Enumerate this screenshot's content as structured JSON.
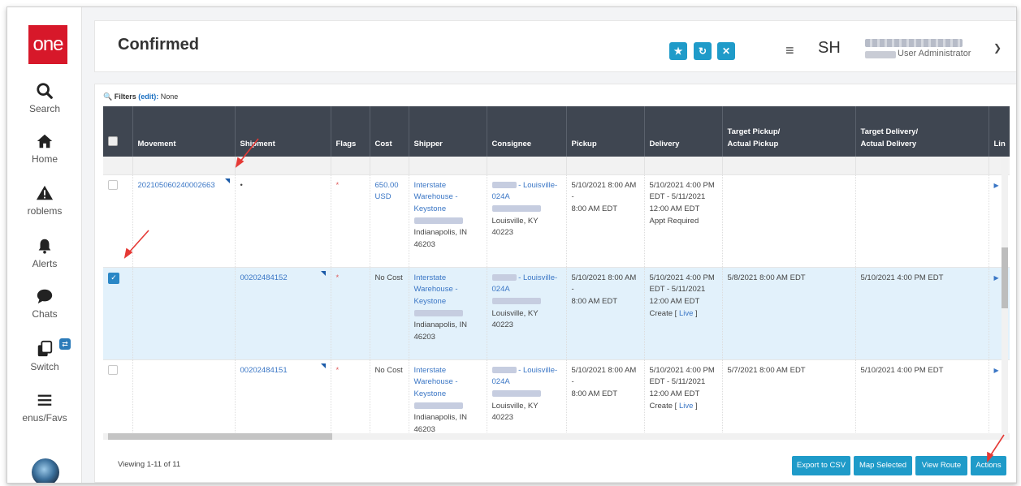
{
  "app": {
    "logo_text": "one",
    "title": "Confirmed"
  },
  "sidebar": {
    "items": [
      {
        "label": "Search",
        "icon": "search-icon"
      },
      {
        "label": "Home",
        "icon": "home-icon"
      },
      {
        "label": "Problems",
        "icon": "warning-icon",
        "display": "roblems"
      },
      {
        "label": "Alerts",
        "icon": "bell-icon"
      },
      {
        "label": "Chats",
        "icon": "chat-icon"
      },
      {
        "label": "Switch",
        "icon": "switch-icon"
      },
      {
        "label": "Menus/Favs",
        "icon": "menu-icon",
        "display": "enus/Favs"
      }
    ]
  },
  "header": {
    "buttons": [
      {
        "name": "favorite-star",
        "glyph": "★"
      },
      {
        "name": "refresh",
        "glyph": "↻"
      },
      {
        "name": "close",
        "glyph": "✕"
      }
    ],
    "user_initials": "SH",
    "user_role": "User Administrator"
  },
  "filters": {
    "label": "Filters",
    "edit": "(edit):",
    "value": "None"
  },
  "table": {
    "columns": [
      "",
      "Movement",
      "Shipment",
      "Flags",
      "Cost",
      "Shipper",
      "Consignee",
      "Pickup",
      "Delivery",
      "Target Pickup/\nActual Pickup",
      "Target Delivery/\nActual Delivery",
      "Lin"
    ],
    "rows": [
      {
        "selected": false,
        "movement": "202105060240002663",
        "shipment": "•",
        "flags": "*",
        "cost": "650.00 USD",
        "shipper": [
          "Interstate",
          "Warehouse -",
          "Keystone"
        ],
        "shipper_addr": [
          "Indianapolis, IN",
          "46203"
        ],
        "consignee_suffix": "- Louisville-",
        "consignee_code": "024A",
        "consignee_addr": "Louisville, KY 40223",
        "pickup": [
          "5/10/2021 8:00 AM -",
          "8:00 AM EDT"
        ],
        "delivery": [
          "5/10/2021 4:00 PM",
          "EDT - 5/11/2021",
          "12:00 AM EDT",
          "Appt Required"
        ],
        "target_pickup": "",
        "target_delivery": ""
      },
      {
        "selected": true,
        "movement": "",
        "shipment": "00202484152",
        "flags": "*",
        "cost": "No Cost",
        "shipper": [
          "Interstate",
          "Warehouse -",
          "Keystone"
        ],
        "shipper_addr": [
          "Indianapolis, IN",
          "46203"
        ],
        "consignee_suffix": "- Louisville-",
        "consignee_code": "024A",
        "consignee_addr": "Louisville, KY 40223",
        "pickup": [
          "5/10/2021 8:00 AM -",
          "8:00 AM EDT"
        ],
        "delivery": [
          "5/10/2021 4:00 PM",
          "EDT - 5/11/2021",
          "12:00 AM EDT"
        ],
        "delivery_link_prefix": "Create [ ",
        "delivery_link": "Live",
        "delivery_link_suffix": " ]",
        "target_pickup": "5/8/2021 8:00 AM EDT",
        "target_delivery": "5/10/2021 4:00 PM EDT"
      },
      {
        "selected": false,
        "movement": "",
        "shipment": "00202484151",
        "flags": "*",
        "cost": "No Cost",
        "shipper": [
          "Interstate",
          "Warehouse -",
          "Keystone"
        ],
        "shipper_addr": [
          "Indianapolis, IN",
          "46203"
        ],
        "consignee_suffix": "- Louisville-",
        "consignee_code": "024A",
        "consignee_addr": "Louisville, KY 40223",
        "pickup": [
          "5/10/2021 8:00 AM -",
          "8:00 AM EDT"
        ],
        "delivery": [
          "5/10/2021 4:00 PM",
          "EDT - 5/11/2021",
          "12:00 AM EDT"
        ],
        "delivery_link_prefix": "Create [ ",
        "delivery_link": "Live",
        "delivery_link_suffix": " ]",
        "target_pickup": "5/7/2021 8:00 AM EDT",
        "target_delivery": "5/10/2021 4:00 PM EDT"
      }
    ]
  },
  "footer": {
    "viewing": "Viewing 1-11 of 11",
    "buttons": [
      "Export to CSV",
      "Map Selected",
      "View Route",
      "Actions"
    ]
  },
  "colors": {
    "accent": "#1f9bc9",
    "header_dark": "#3f4651",
    "selected_row": "#e2f1fb",
    "logo_red": "#d7182a",
    "annotation": "#e53935"
  }
}
